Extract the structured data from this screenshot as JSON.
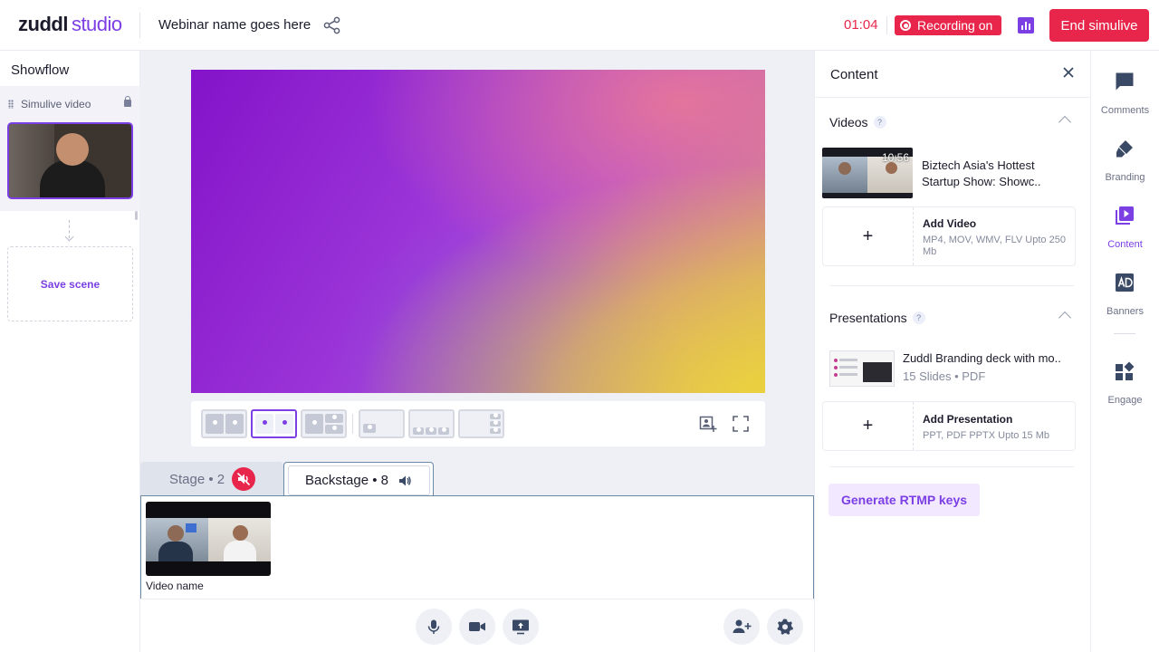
{
  "app": {
    "brand": "zuddl",
    "product": "studio"
  },
  "header": {
    "webinar_name": "Webinar name goes here",
    "timer": "01:04",
    "recording_label": "Recording on",
    "end_label": "End simulive"
  },
  "showflow": {
    "title": "Showflow",
    "scene_label": "Simulive video",
    "save_scene_label": "Save scene"
  },
  "stage": {
    "layout_options": 6,
    "selected_layout": 2
  },
  "tabs": {
    "stage_label": "Stage • 2",
    "backstage_label": "Backstage • 8"
  },
  "backstage": {
    "video_name": "Video name"
  },
  "content": {
    "title": "Content",
    "videos_title": "Videos",
    "help_glyph": "?",
    "video_item": {
      "duration": "10:56",
      "title": "Biztech Asia's Hottest Startup Show: Showc.."
    },
    "add_video": {
      "plus": "+",
      "label": "Add Video",
      "desc": "MP4, MOV, WMV, FLV Upto 250 Mb"
    },
    "presentations_title": "Presentations",
    "presentation_item": {
      "title": "Zuddl Branding deck with mo..",
      "meta": "15 Slides • PDF"
    },
    "add_presentation": {
      "plus": "+",
      "label": "Add Presentation",
      "desc": "PPT, PDF PPTX Upto 15 Mb"
    },
    "rtmp_label": "Generate RTMP keys"
  },
  "rail": {
    "items": [
      {
        "label": "Comments",
        "icon": "comment-icon"
      },
      {
        "label": "Branding",
        "icon": "brush-icon"
      },
      {
        "label": "Content",
        "icon": "play-library-icon",
        "active": true
      },
      {
        "label": "Banners",
        "icon": "ad-icon"
      },
      {
        "label": "Engage",
        "icon": "widgets-icon"
      }
    ]
  },
  "colors": {
    "accent": "#7b3fe4",
    "danger": "#e8264b",
    "panel_bg": "#eef0f5"
  }
}
